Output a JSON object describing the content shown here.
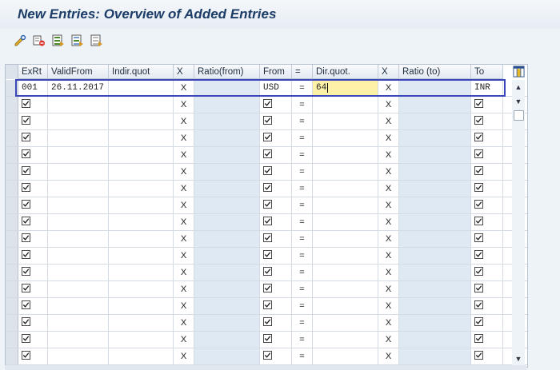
{
  "window": {
    "title": "New Entries: Overview of Added Entries"
  },
  "toolbar": {
    "buttons": [
      {
        "icon": "change-display-icon"
      },
      {
        "icon": "delete-row-icon"
      },
      {
        "icon": "select-all-icon"
      },
      {
        "icon": "select-block-icon"
      },
      {
        "icon": "deselect-all-icon"
      }
    ]
  },
  "table": {
    "columns": [
      "ExRt",
      "ValidFrom",
      "Indir.quot",
      "X",
      "Ratio(from)",
      "From",
      "=",
      "Dir.quot.",
      "X",
      "Ratio (to)",
      "To"
    ],
    "first_row": {
      "exrt": "001",
      "valid_from": "26.11.2017",
      "indir_quot": "",
      "x1": "X",
      "ratio_from": "",
      "from": "USD",
      "eq": "=",
      "dir_quot": "64",
      "x2": "X",
      "ratio_to": "",
      "to": "INR"
    },
    "empty_row": {
      "x": "X",
      "eq": "="
    },
    "empty_row_count": 17,
    "checkbox_icon": "checkbox-checked-icon"
  },
  "scrollbar": {
    "up": "▲",
    "down": "▼"
  },
  "colors": {
    "highlight": "#3b46b8",
    "editing_cell": "#fff2a8",
    "title": "#1b3c66"
  }
}
